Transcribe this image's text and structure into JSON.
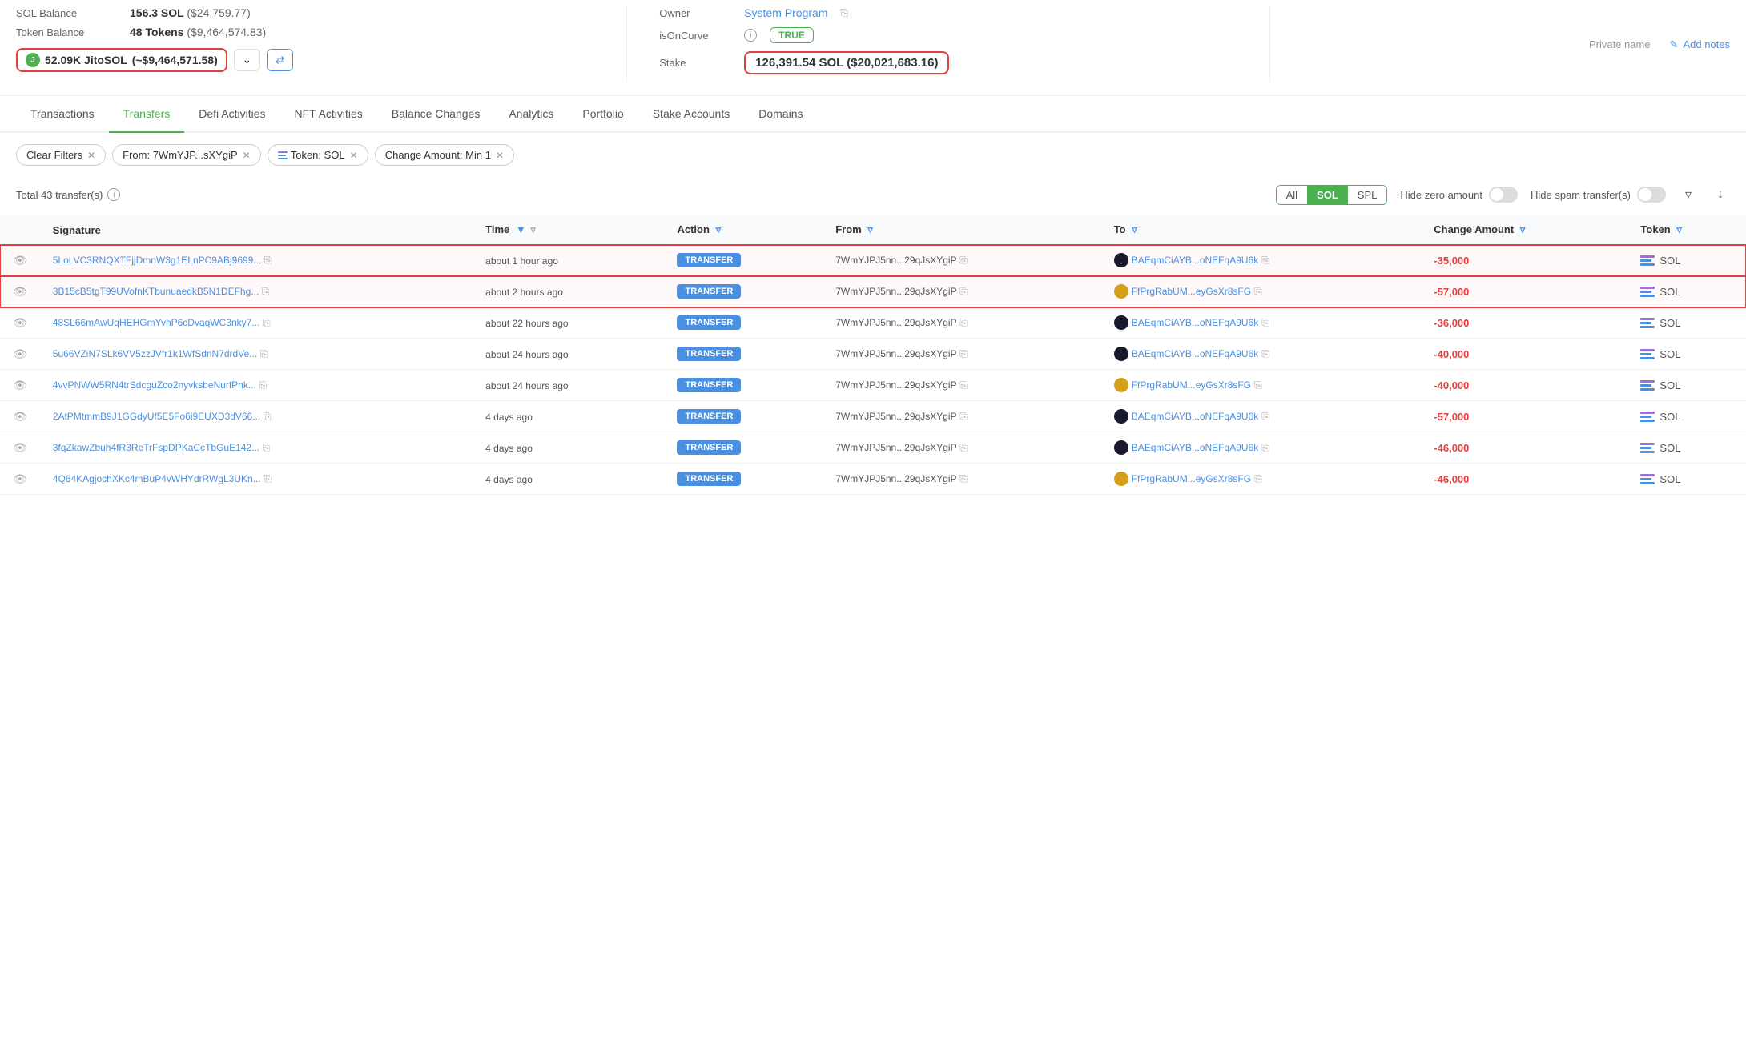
{
  "header": {
    "sol_balance_label": "SOL Balance",
    "sol_balance_value": "156.3 SOL",
    "sol_balance_usd": "($24,759.77)",
    "token_balance_label": "Token Balance",
    "token_balance_value": "48 Tokens",
    "token_balance_usd": "($9,464,574.83)",
    "jito_amount": "52.09K JitoSOL",
    "jito_usd": "(~$9,464,571.58)",
    "owner_label": "Owner",
    "owner_value": "System Program",
    "iscurve_label": "isOnCurve",
    "iscurve_value": "TRUE",
    "stake_label": "Stake",
    "stake_value": "126,391.54 SOL",
    "stake_usd": "($20,021,683.16)",
    "private_name": "Private name",
    "add_notes": "Add notes"
  },
  "tabs": [
    {
      "label": "Transactions",
      "active": false
    },
    {
      "label": "Transfers",
      "active": true
    },
    {
      "label": "Defi Activities",
      "active": false
    },
    {
      "label": "NFT Activities",
      "active": false
    },
    {
      "label": "Balance Changes",
      "active": false
    },
    {
      "label": "Analytics",
      "active": false
    },
    {
      "label": "Portfolio",
      "active": false
    },
    {
      "label": "Stake Accounts",
      "active": false
    },
    {
      "label": "Domains",
      "active": false
    }
  ],
  "filters": {
    "clear": "Clear Filters",
    "from": "From: 7WmYJP...sXYgiP",
    "token": "Token: SOL",
    "change_amount": "Change Amount: Min 1"
  },
  "table_controls": {
    "total": "Total 43 transfer(s)",
    "all": "All",
    "sol": "SOL",
    "spl": "SPL",
    "hide_zero": "Hide zero amount",
    "hide_spam": "Hide spam transfer(s)"
  },
  "columns": {
    "signature": "Signature",
    "time": "Time",
    "action": "Action",
    "from": "From",
    "to": "To",
    "change_amount": "Change Amount",
    "token": "Token"
  },
  "rows": [
    {
      "sig": "5LoLVC3RNQXTFjjDmnW3g1ELnPC9ABj9699...",
      "time": "about 1 hour ago",
      "action": "TRANSFER",
      "from": "7WmYJPJ5nn...29qJsXYgiP",
      "to": "BAEqmCiAYB...oNEFqA9U6k",
      "to_dark": true,
      "change": "-35,000",
      "token": "SOL",
      "highlighted": true
    },
    {
      "sig": "3B15cB5tgT99UVofnKTbunuaedkB5N1DEFhg...",
      "time": "about 2 hours ago",
      "action": "TRANSFER",
      "from": "7WmYJPJ5nn...29qJsXYgiP",
      "to": "FfPrgRabUM...eyGsXr8sFG",
      "to_dark": false,
      "change": "-57,000",
      "token": "SOL",
      "highlighted": true
    },
    {
      "sig": "48SL66mAwUqHEHGmYvhP6cDvaqWC3nky7...",
      "time": "about 22 hours ago",
      "action": "TRANSFER",
      "from": "7WmYJPJ5nn...29qJsXYgiP",
      "to": "BAEqmCiAYB...oNEFqA9U6k",
      "to_dark": true,
      "change": "-36,000",
      "token": "SOL",
      "highlighted": false
    },
    {
      "sig": "5u66VZiN7SLk6VV5zzJVfr1k1WfSdnN7drdVe...",
      "time": "about 24 hours ago",
      "action": "TRANSFER",
      "from": "7WmYJPJ5nn...29qJsXYgiP",
      "to": "BAEqmCiAYB...oNEFqA9U6k",
      "to_dark": true,
      "change": "-40,000",
      "token": "SOL",
      "highlighted": false
    },
    {
      "sig": "4vvPNWW5RN4trSdcguZco2nyvksbeNurfPnk...",
      "time": "about 24 hours ago",
      "action": "TRANSFER",
      "from": "7WmYJPJ5nn...29qJsXYgiP",
      "to": "FfPrgRabUM...eyGsXr8sFG",
      "to_dark": false,
      "change": "-40,000",
      "token": "SOL",
      "highlighted": false
    },
    {
      "sig": "2AtPMtmmB9J1GGdyUf5E5Fo6i9EUXD3dV66...",
      "time": "4 days ago",
      "action": "TRANSFER",
      "from": "7WmYJPJ5nn...29qJsXYgiP",
      "to": "BAEqmCiAYB...oNEFqA9U6k",
      "to_dark": true,
      "change": "-57,000",
      "token": "SOL",
      "highlighted": false
    },
    {
      "sig": "3fqZkawZbuh4fR3ReTrFspDPKaCcTbGuE142...",
      "time": "4 days ago",
      "action": "TRANSFER",
      "from": "7WmYJPJ5nn...29qJsXYgiP",
      "to": "BAEqmCiAYB...oNEFqA9U6k",
      "to_dark": true,
      "change": "-46,000",
      "token": "SOL",
      "highlighted": false
    },
    {
      "sig": "4Q64KAgjochXKc4mBuP4vWHYdrRWgL3UKn...",
      "time": "4 days ago",
      "action": "TRANSFER",
      "from": "7WmYJPJ5nn...29qJsXYgiP",
      "to": "FfPrgRabUM...eyGsXr8sFG",
      "to_dark": false,
      "change": "-46,000",
      "token": "SOL",
      "highlighted": false
    }
  ]
}
